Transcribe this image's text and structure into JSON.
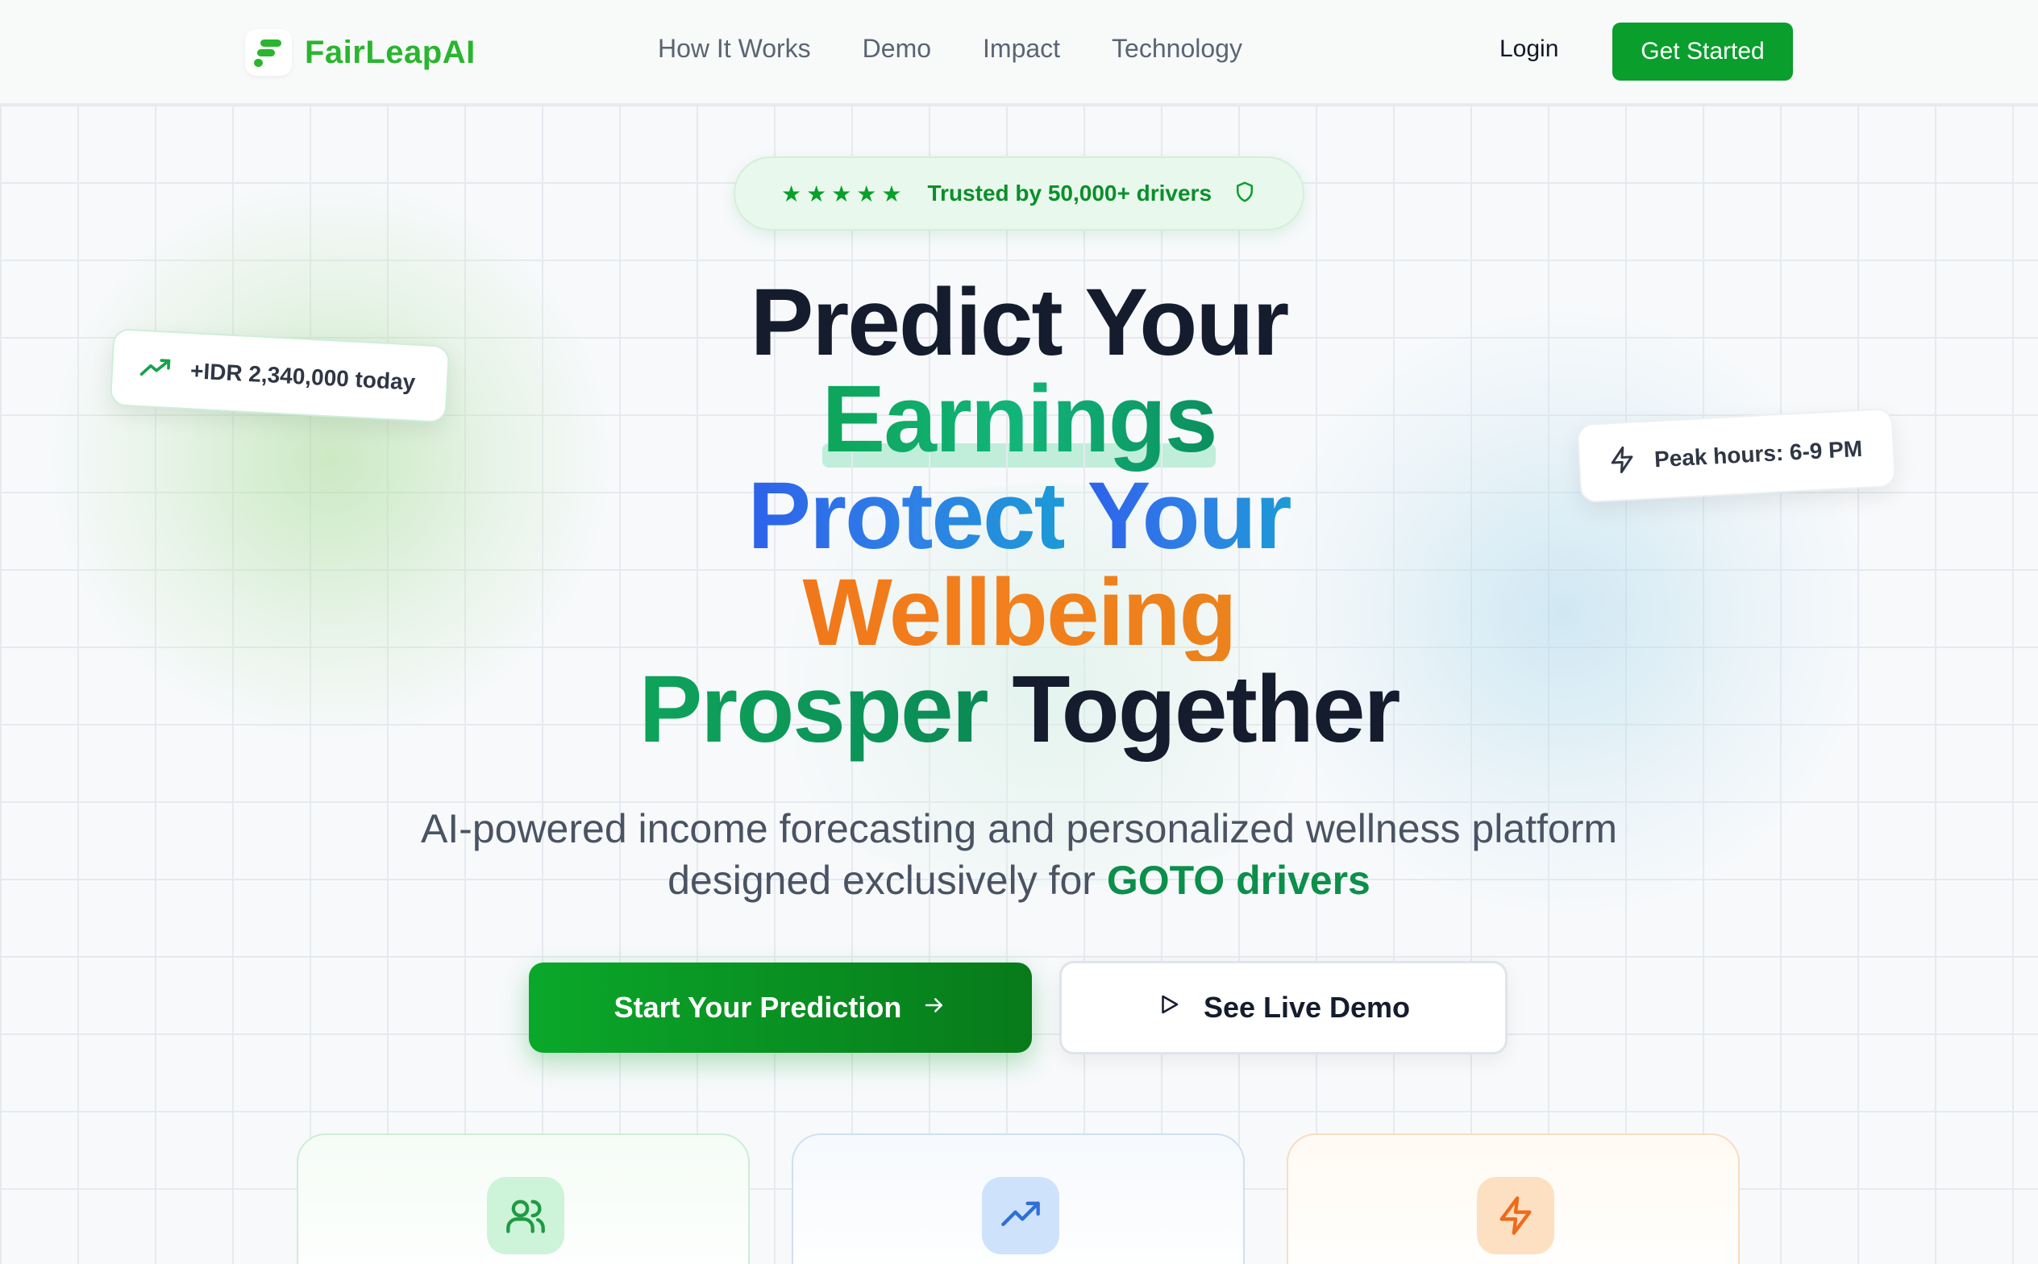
{
  "nav": {
    "brand": "FairLeapAI",
    "links": [
      "How It Works",
      "Demo",
      "Impact",
      "Technology"
    ],
    "login": "Login",
    "get_started": "Get Started"
  },
  "badge": {
    "stars": "★★★★★",
    "text": "Trusted by 50,000+ drivers"
  },
  "floating": {
    "earnings": "+IDR 2,340,000 today",
    "peak": "Peak hours: 6-9 PM"
  },
  "headline": {
    "line1": "Predict Your",
    "line2": "Earnings",
    "line3a": "Protect",
    "line3b": "Your",
    "line4": "Wellbeing",
    "line5a": "Prosper",
    "line5b": "Together"
  },
  "subtitle": {
    "line1": "AI-powered income forecasting and personalized wellness platform",
    "line2_prefix": "designed exclusively for",
    "line2_highlight": "GOTO drivers"
  },
  "cta": {
    "primary": "Start Your Prediction",
    "secondary": "See Live Demo"
  },
  "features": [
    {
      "icon": "users-icon",
      "color": "#1f9a44"
    },
    {
      "icon": "trending-up-icon",
      "color": "#2f6fd6"
    },
    {
      "icon": "zap-icon",
      "color": "#ef6a1b"
    }
  ],
  "colors": {
    "brand_green": "#0a9e2c",
    "dark_text": "#141c2e",
    "blue_gradient": "#2d62ea",
    "orange_gradient": "#ee5a14"
  }
}
